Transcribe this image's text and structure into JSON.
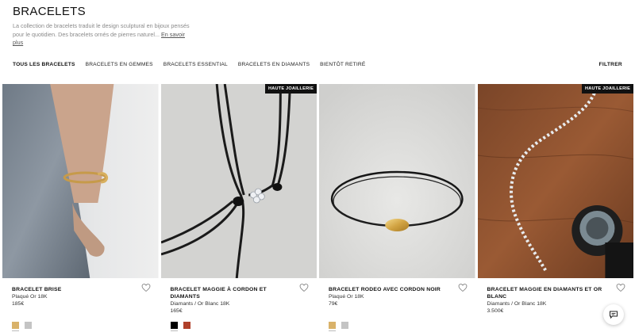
{
  "header": {
    "title": "BRACELETS",
    "intro_text": "La collection de bracelets traduit le design sculptural en bijoux pensés pour le quotidien. Des bracelets ornés de pierres naturel...",
    "more_link": "En savoir plus"
  },
  "tabs": [
    {
      "label": "TOUS LES BRACELETS",
      "active": true
    },
    {
      "label": "BRACELETS EN GEMMES",
      "active": false
    },
    {
      "label": "BRACELETS ESSENTIAL",
      "active": false
    },
    {
      "label": "BRACELETS EN DIAMANTS",
      "active": false
    },
    {
      "label": "BIENTÔT RETIRÉ",
      "active": false
    }
  ],
  "filter_label": "FILTRER",
  "products": [
    {
      "name": "BRACELET BRISE",
      "material": "Plaqué Or 18K",
      "price": "185€",
      "badge": "",
      "swatches": [
        "#d9b26a",
        "#c4c4c4"
      ]
    },
    {
      "name": "BRACELET MAGGIE À CORDON ET DIAMANTS",
      "material": "Diamants / Or Blanc 18K",
      "price": "165€",
      "badge": "HAUTE JOAILLERIE",
      "swatches": [
        "#000000",
        "#b0402a"
      ]
    },
    {
      "name": "BRACELET RODEO AVEC CORDON NOIR",
      "material": "Plaqué Or 18K",
      "price": "79€",
      "badge": "",
      "swatches": [
        "#d9b26a",
        "#c4c4c4"
      ]
    },
    {
      "name": "BRACELET MAGGIE EN DIAMANTS ET OR BLANC",
      "material": "Diamants / Or Blanc 18K",
      "price": "3.500€",
      "badge": "HAUTE JOAILLERIE",
      "swatches": []
    }
  ],
  "icons": {
    "favorite": "heart-outline-icon",
    "chat": "chat-bubble-icon"
  }
}
